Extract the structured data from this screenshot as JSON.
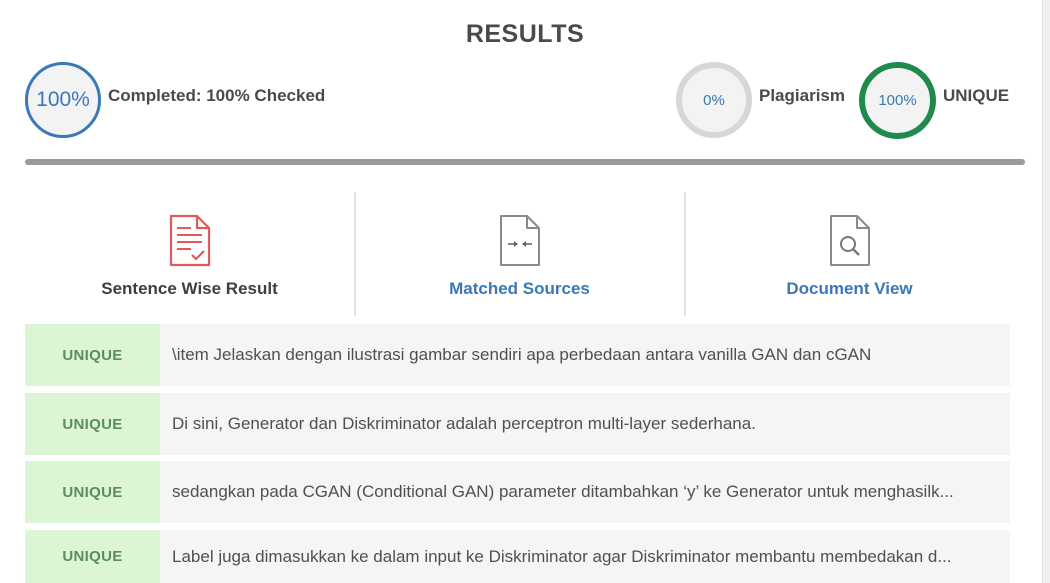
{
  "header": {
    "title": "RESULTS"
  },
  "stats": {
    "completed_percent": "100%",
    "completed_label": "Completed: 100% Checked",
    "plagiarism_percent": "0%",
    "plagiarism_label": "Plagiarism",
    "unique_percent": "100%",
    "unique_label": "UNIQUE"
  },
  "colors": {
    "accent_blue": "#3a78b8",
    "unique_green": "#1f8a4c",
    "badge_bg": "#dcf5d4",
    "icon_red": "#e05a5a"
  },
  "tabs": [
    {
      "label": "Sentence Wise Result",
      "icon": "document-check-icon"
    },
    {
      "label": "Matched Sources",
      "icon": "document-compare-icon"
    },
    {
      "label": "Document View",
      "icon": "document-search-icon"
    }
  ],
  "results": [
    {
      "status": "UNIQUE",
      "text": "\\item Jelaskan dengan ilustrasi gambar sendiri apa perbedaan antara vanilla GAN dan cGAN"
    },
    {
      "status": "UNIQUE",
      "text": "Di sini, Generator dan Diskriminator adalah perceptron multi-layer sederhana."
    },
    {
      "status": "UNIQUE",
      "text": "sedangkan pada CGAN (Conditional GAN) parameter ditambahkan ‘y’ ke Generator untuk menghasilk..."
    },
    {
      "status": "UNIQUE",
      "text": "Label juga dimasukkan ke dalam input ke Diskriminator agar Diskriminator membantu membedakan d..."
    }
  ]
}
